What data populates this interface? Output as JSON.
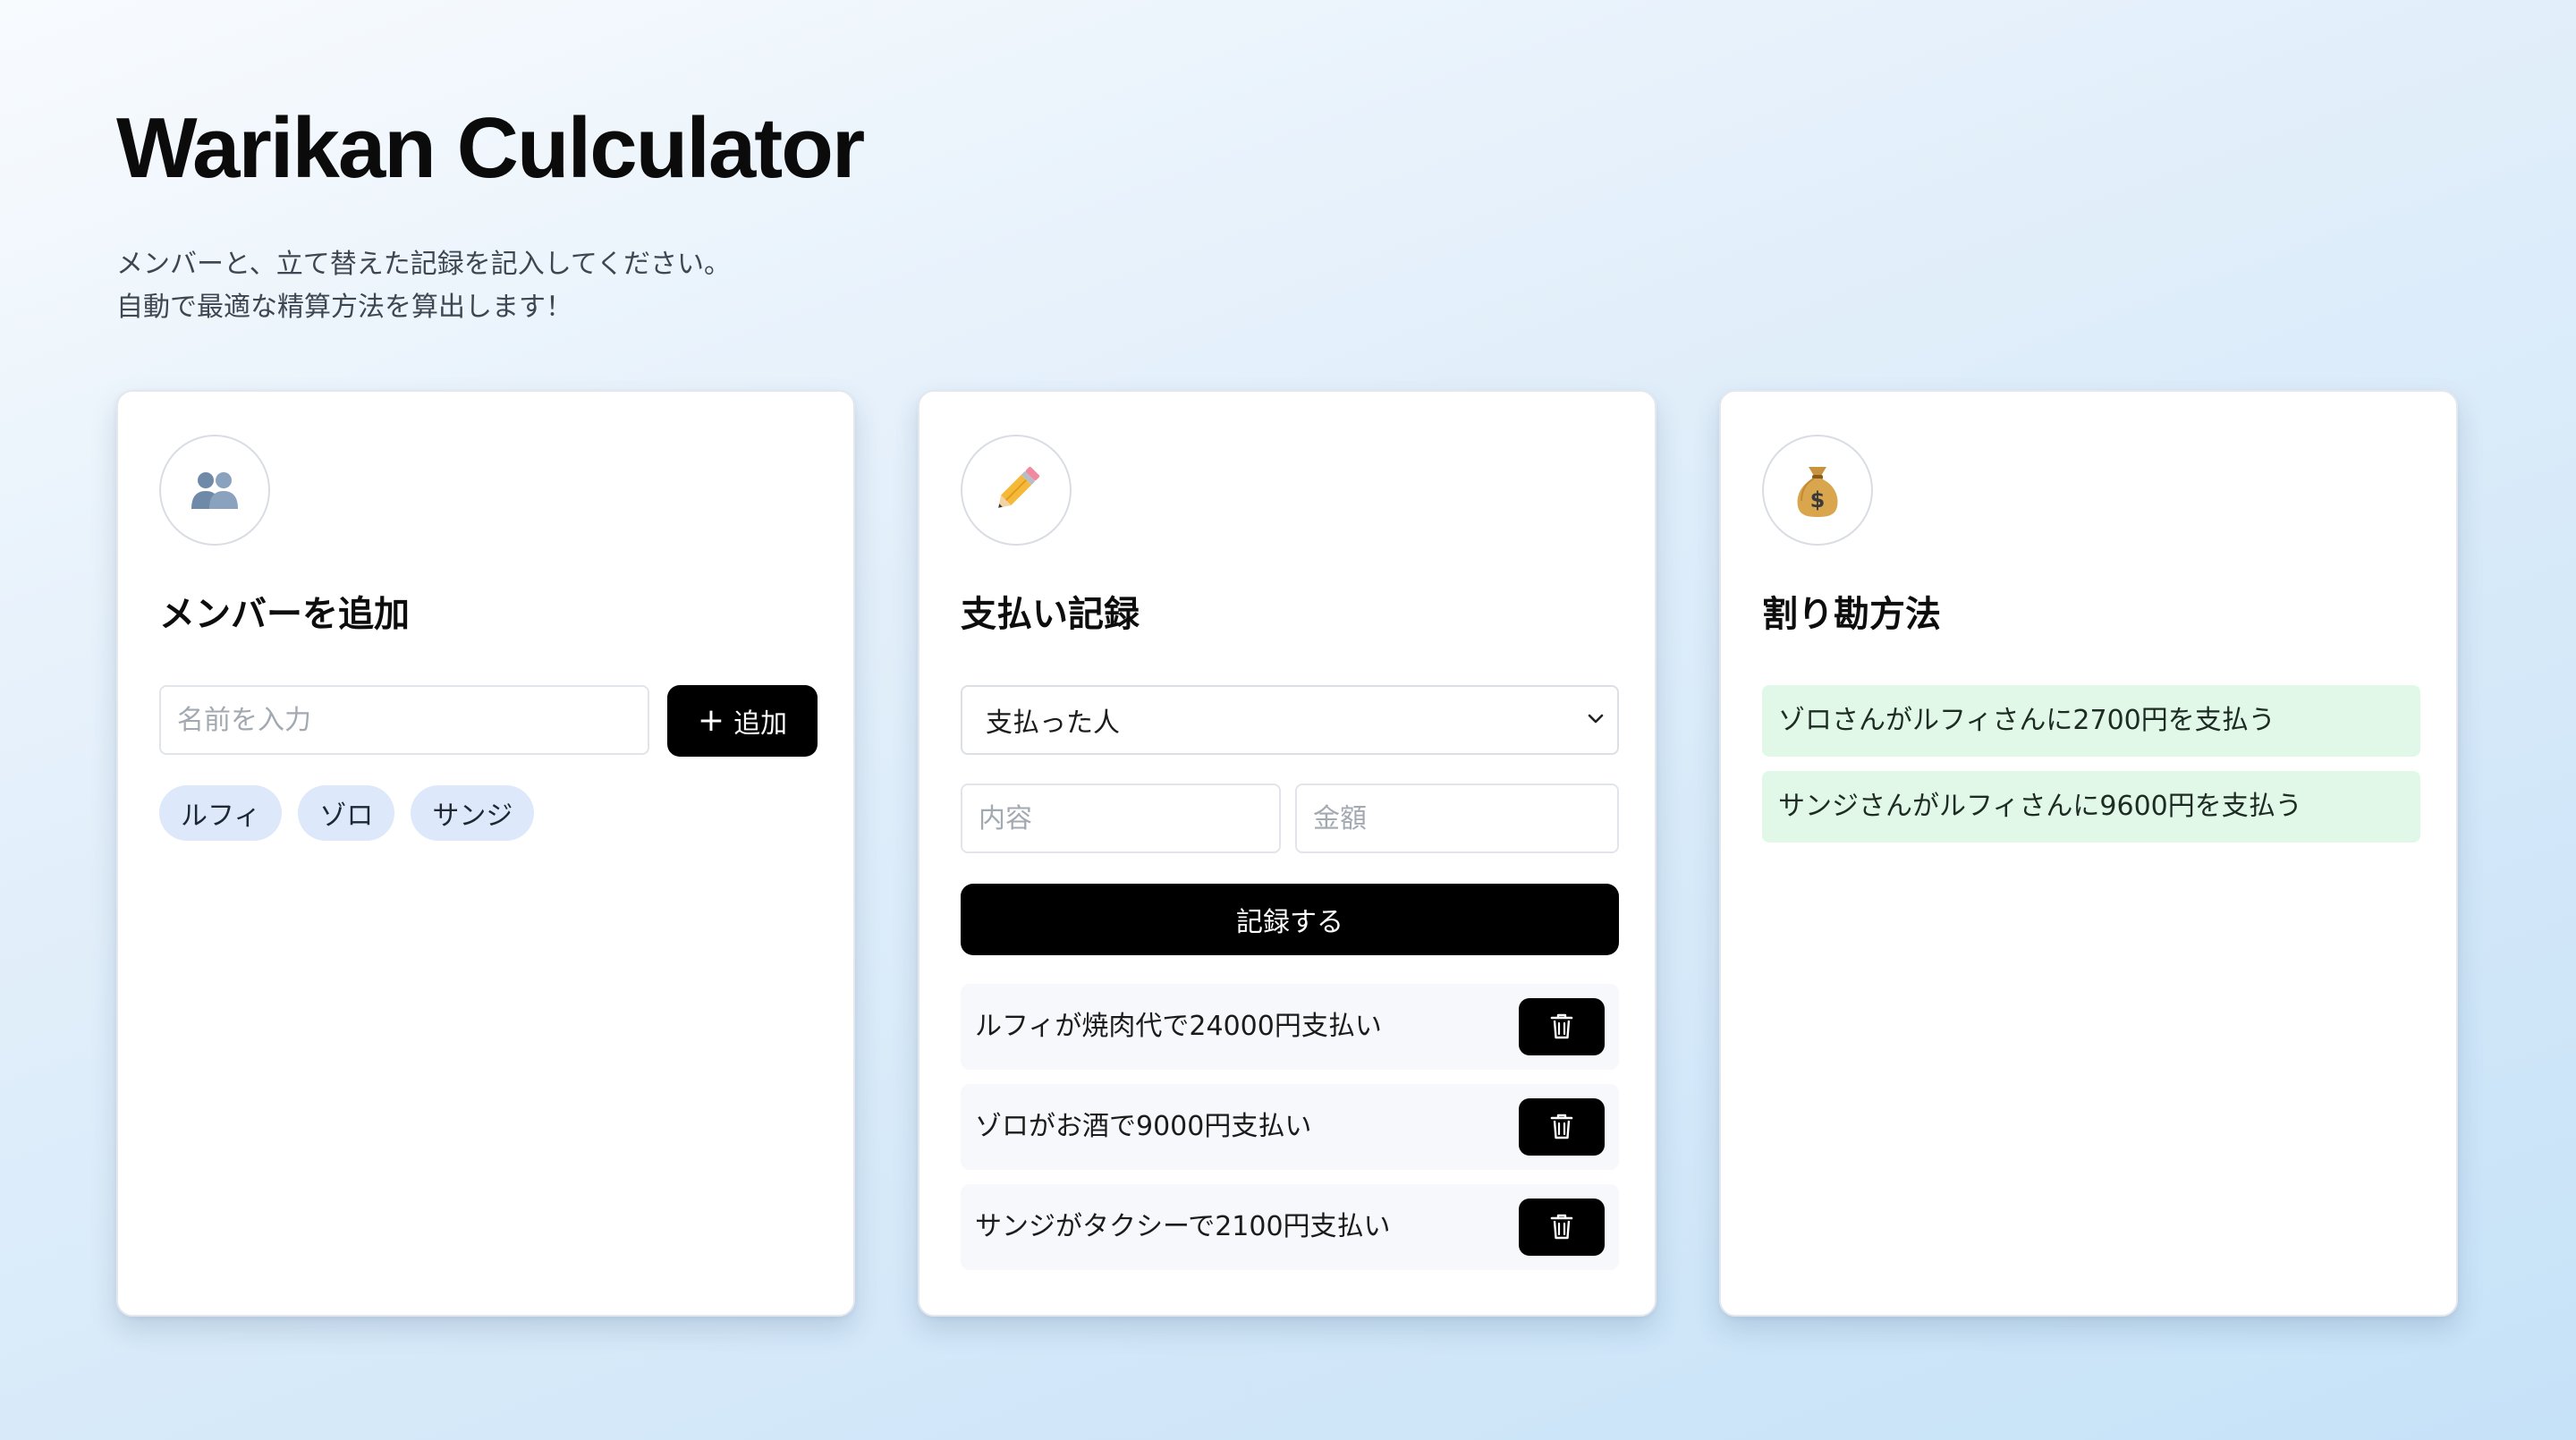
{
  "header": {
    "title": "Warikan Culculator",
    "subtitle_line1": "メンバーと、立て替えた記録を記入してください。",
    "subtitle_line2": "自動で最適な精算方法を算出します！"
  },
  "members_card": {
    "icon": "busts-in-silhouette-icon",
    "title": "メンバーを追加",
    "name_placeholder": "名前を入力",
    "add_button_label": "追加",
    "members": [
      "ルフィ",
      "ゾロ",
      "サンジ"
    ]
  },
  "payments_card": {
    "icon": "pencil-icon",
    "title": "支払い記録",
    "payer_select_value": "支払った人",
    "description_placeholder": "内容",
    "amount_placeholder": "金額",
    "record_button_label": "記録する",
    "payments": [
      "ルフィが焼肉代で24000円支払い",
      "ゾロがお酒で9000円支払い",
      "サンジがタクシーで2100円支払い"
    ]
  },
  "settlement_card": {
    "icon": "money-bag-icon",
    "title": "割り勘方法",
    "settlements": [
      "ゾロさんがルフィさんに2700円を支払う",
      "サンジさんがルフィさんに9600円を支払う"
    ]
  },
  "colors": {
    "accent": "#000000",
    "chip_bg": "#dde8fb",
    "settlement_bg": "#e1f8e9",
    "payment_row_bg": "#f6f8fb"
  }
}
